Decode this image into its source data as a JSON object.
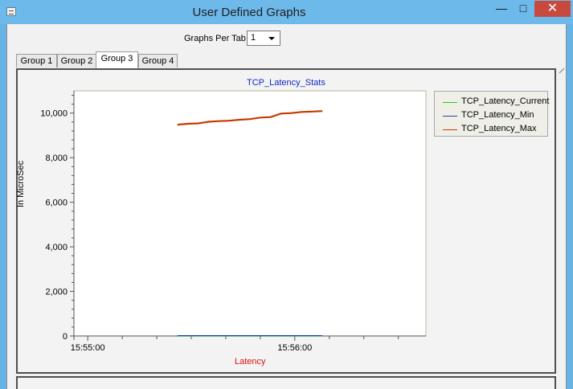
{
  "window": {
    "title": "User Defined Graphs",
    "min_glyph": "—",
    "max_glyph": "□",
    "close_glyph": "✕"
  },
  "controls": {
    "graphs_per_tab_label": "Graphs Per Tab",
    "graphs_per_tab_value": "1"
  },
  "tabs": [
    {
      "label": "Group 1",
      "active": false
    },
    {
      "label": "Group 2",
      "active": false
    },
    {
      "label": "Group 3",
      "active": true
    },
    {
      "label": "Group 4",
      "active": false
    }
  ],
  "colors": {
    "current": "#22cc22",
    "min": "#2040c0",
    "max": "#c83800",
    "title": "#1028c8",
    "xlabel": "#dd1111"
  },
  "chart_data": {
    "type": "line",
    "title": "TCP_Latency_Stats",
    "xlabel": "Latency",
    "ylabel": "In MicroSec",
    "ylim": [
      0,
      11000
    ],
    "yticks": [
      0,
      2000,
      4000,
      6000,
      8000,
      10000
    ],
    "ytick_labels": [
      "0",
      "2,000",
      "4,000",
      "6,000",
      "8,000",
      "10,000"
    ],
    "xlim": [
      "15:54:56",
      "15:56:38"
    ],
    "xticks": [
      "15:55:00",
      "15:56:00"
    ],
    "grid": false,
    "legend": "right",
    "x": [
      "15:55:26",
      "15:55:29",
      "15:55:32",
      "15:55:35",
      "15:55:38",
      "15:55:41",
      "15:55:44",
      "15:55:47",
      "15:55:50",
      "15:55:53",
      "15:55:56",
      "15:55:59",
      "15:56:02",
      "15:56:05",
      "15:56:08"
    ],
    "series": [
      {
        "name": "TCP_Latency_Current",
        "color": "#22cc22",
        "values": [
          0,
          0,
          0,
          0,
          0,
          0,
          0,
          0,
          0,
          0,
          0,
          0,
          0,
          0,
          0
        ]
      },
      {
        "name": "TCP_Latency_Min",
        "color": "#2040c0",
        "values": [
          15,
          15,
          15,
          15,
          15,
          15,
          15,
          15,
          15,
          15,
          15,
          15,
          15,
          15,
          15
        ]
      },
      {
        "name": "TCP_Latency_Max",
        "color": "#c83800",
        "values": [
          9480,
          9520,
          9540,
          9610,
          9640,
          9660,
          9700,
          9730,
          9800,
          9820,
          9980,
          10000,
          10050,
          10070,
          10090
        ]
      }
    ]
  }
}
